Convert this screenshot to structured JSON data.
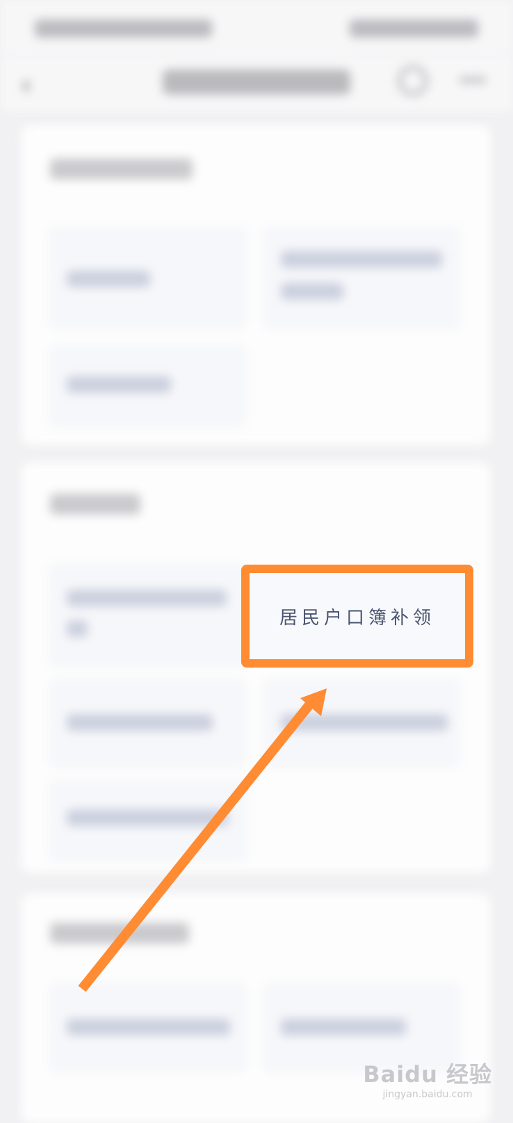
{
  "highlighted_tile": {
    "label": "居民户口簿补领"
  },
  "annotation": {
    "box_color": "#ff8b33",
    "arrow_color": "#ff8b33"
  },
  "watermark": {
    "main": "Baidu 经验",
    "sub": "jingyan.baidu.com"
  }
}
